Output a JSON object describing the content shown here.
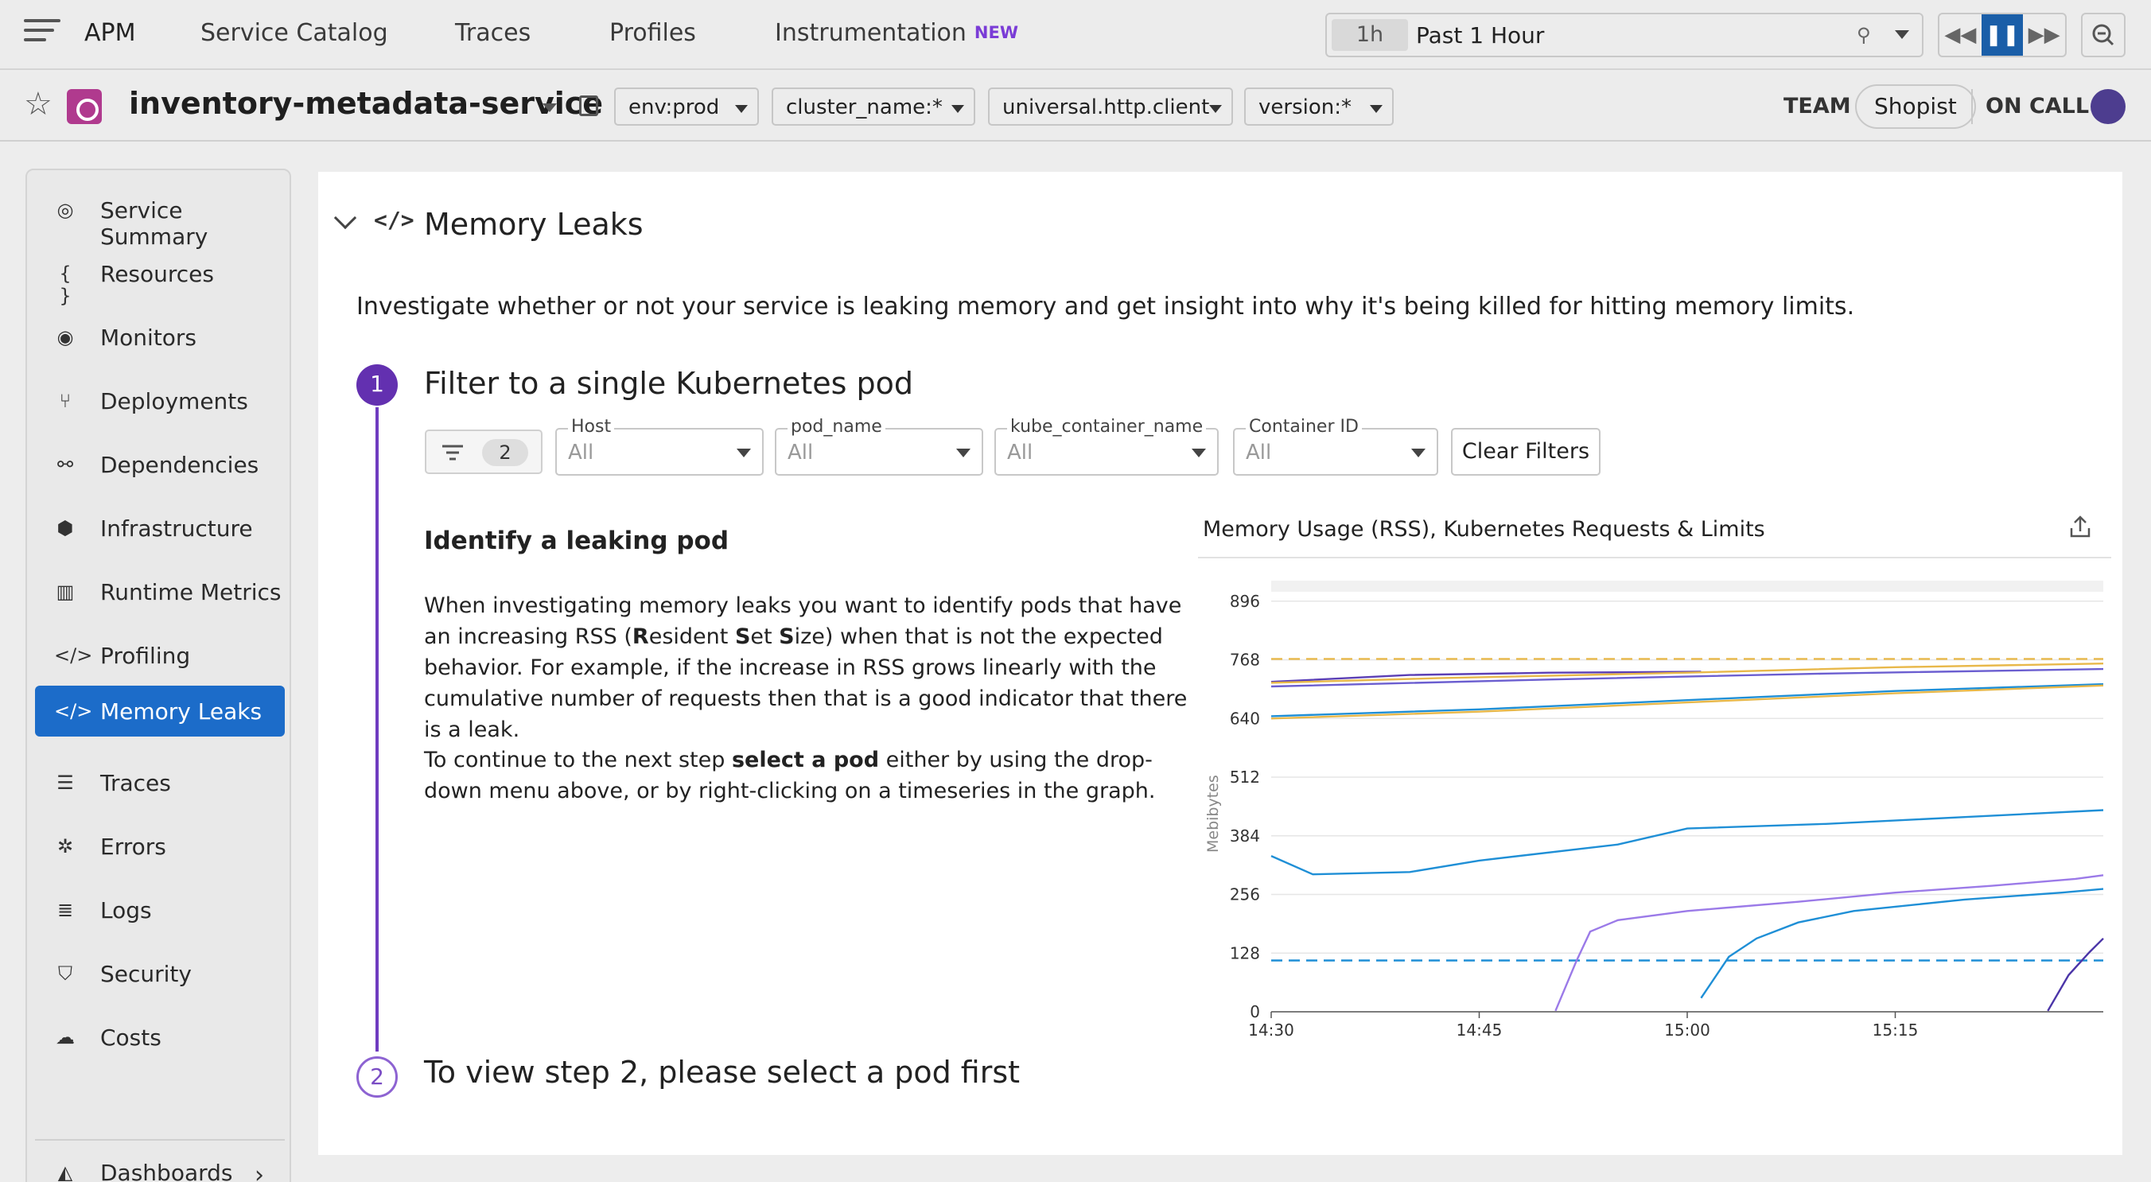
{
  "topbar": {
    "brand": "APM",
    "nav": [
      "Service Catalog",
      "Traces",
      "Profiles",
      "Instrumentation"
    ],
    "new_badge": "NEW",
    "time_chip": "1h",
    "time_label": "Past 1 Hour"
  },
  "service": {
    "name": "inventory-metadata-service",
    "filters": [
      "env:prod",
      "cluster_name:*",
      "universal.http.client",
      "version:*"
    ],
    "team_label": "TEAM",
    "team_name": "Shopist",
    "oncall_label": "ON CALL"
  },
  "sidebar": {
    "items": [
      {
        "label": "Service Summary",
        "icon": "globe-icon"
      },
      {
        "label": "Resources",
        "icon": "braces-icon"
      },
      {
        "label": "Monitors",
        "icon": "monitor-icon"
      },
      {
        "label": "Deployments",
        "icon": "branch-icon"
      },
      {
        "label": "Dependencies",
        "icon": "dependencies-icon"
      },
      {
        "label": "Infrastructure",
        "icon": "hexagon-icon"
      },
      {
        "label": "Runtime Metrics",
        "icon": "bar-chart-icon"
      },
      {
        "label": "Profiling",
        "icon": "code-icon"
      },
      {
        "label": "Memory Leaks",
        "icon": "code-icon"
      },
      {
        "label": "Traces",
        "icon": "traces-icon"
      },
      {
        "label": "Errors",
        "icon": "bug-icon"
      },
      {
        "label": "Logs",
        "icon": "logs-icon"
      },
      {
        "label": "Security",
        "icon": "shield-icon"
      },
      {
        "label": "Costs",
        "icon": "costs-icon"
      }
    ],
    "active_index": 8,
    "footer_item": "Dashboards"
  },
  "main": {
    "section_title": "Memory Leaks",
    "intro": "Investigate whether or not your service is leaking memory and get insight into why it's being killed for hitting memory limits.",
    "step1": {
      "number": "1",
      "title": "Filter to a single Kubernetes pod",
      "filter_count": "2",
      "selects": [
        {
          "label": "Host",
          "value": "All"
        },
        {
          "label": "pod_name",
          "value": "All"
        },
        {
          "label": "kube_container_name",
          "value": "All"
        },
        {
          "label": "Container ID",
          "value": "All"
        }
      ],
      "clear_button": "Clear Filters",
      "subhead": "Identify a leaking pod",
      "para1_a": "When investigating memory leaks you want to identify pods that have an increasing RSS (",
      "para1_R": "R",
      "para1_b": "esident ",
      "para1_S1": "S",
      "para1_c": "et ",
      "para1_S2": "S",
      "para1_d": "ize) when that is not the expected behavior. For example, if the increase in RSS grows linearly with the cumulative number of requests then that is a good indicator that there is a leak.",
      "para2_a": "To continue to the next step ",
      "para2_bold": "select a pod",
      "para2_b": " either by using the drop-down menu above, or by right-clicking on a timeseries in the graph."
    },
    "step2": {
      "number": "2",
      "title": "To view step 2, please select a pod first"
    }
  },
  "colors": {
    "accent": "#1c6cc9",
    "step": "#6330b0"
  },
  "chart_data": {
    "type": "line",
    "title": "Memory Usage (RSS), Kubernetes Requests & Limits",
    "ylabel": "Mebibytes",
    "yticks": [
      "0",
      "128",
      "256",
      "384",
      "512",
      "640",
      "768",
      "896"
    ],
    "xticks": [
      "14:30",
      "14:45",
      "15:00",
      "15:15"
    ],
    "x_minutes_from_1430": [
      0,
      60
    ],
    "series": [
      {
        "color": "#5b3fb5",
        "points": [
          [
            0,
            720
          ],
          [
            10,
            735
          ],
          [
            20,
            740
          ],
          [
            31,
            742
          ]
        ]
      },
      {
        "color": "#e8b84a",
        "points": [
          [
            0,
            718
          ],
          [
            12,
            728
          ],
          [
            30,
            740
          ],
          [
            45,
            752
          ],
          [
            60,
            760
          ]
        ]
      },
      {
        "color": "#e8b84a",
        "dashed": true,
        "points": [
          [
            0,
            770
          ],
          [
            60,
            770
          ]
        ]
      },
      {
        "color": "#6b5ed0",
        "points": [
          [
            0,
            710
          ],
          [
            20,
            725
          ],
          [
            40,
            738
          ],
          [
            60,
            748
          ]
        ]
      },
      {
        "color": "#1f8fd6",
        "points": [
          [
            0,
            645
          ],
          [
            15,
            660
          ],
          [
            30,
            680
          ],
          [
            45,
            700
          ],
          [
            60,
            715
          ]
        ]
      },
      {
        "color": "#e8b84a",
        "points": [
          [
            0,
            640
          ],
          [
            15,
            655
          ],
          [
            30,
            675
          ],
          [
            45,
            695
          ],
          [
            60,
            712
          ]
        ]
      },
      {
        "color": "#1f8fd6",
        "points": [
          [
            0,
            340
          ],
          [
            3,
            300
          ],
          [
            10,
            305
          ],
          [
            15,
            330
          ],
          [
            25,
            365
          ],
          [
            30,
            400
          ],
          [
            40,
            410
          ],
          [
            50,
            425
          ],
          [
            60,
            440
          ]
        ]
      },
      {
        "color": "#1f8fd6",
        "dashed": true,
        "points": [
          [
            0,
            112
          ],
          [
            60,
            112
          ]
        ]
      },
      {
        "color": "#9b7ae8",
        "points": [
          [
            20.5,
            2
          ],
          [
            22,
            110
          ],
          [
            23,
            175
          ],
          [
            25,
            200
          ],
          [
            30,
            220
          ],
          [
            38,
            240
          ],
          [
            45,
            260
          ],
          [
            52,
            275
          ],
          [
            58,
            290
          ],
          [
            60,
            298
          ]
        ]
      },
      {
        "color": "#1f8fd6",
        "points": [
          [
            31,
            30
          ],
          [
            33,
            120
          ],
          [
            35,
            160
          ],
          [
            38,
            195
          ],
          [
            42,
            220
          ],
          [
            50,
            245
          ],
          [
            57,
            260
          ],
          [
            60,
            268
          ]
        ]
      },
      {
        "color": "#4b35a8",
        "points": [
          [
            56,
            2
          ],
          [
            57.5,
            80
          ],
          [
            59,
            130
          ],
          [
            60,
            160
          ]
        ]
      }
    ]
  }
}
